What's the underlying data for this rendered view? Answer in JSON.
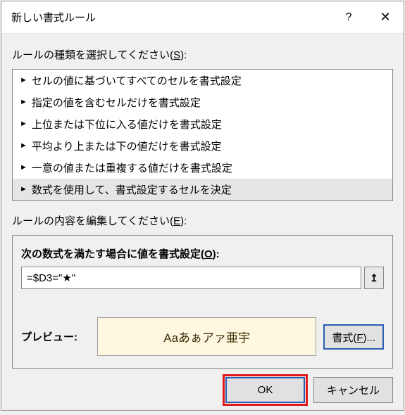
{
  "titlebar": {
    "title": "新しい書式ルール"
  },
  "section1": {
    "label_pre": "ルールの種類を選択してください(",
    "label_u": "S",
    "label_post": "):"
  },
  "rule_types": {
    "items": [
      {
        "text": "セルの値に基づいてすべてのセルを書式設定"
      },
      {
        "text": "指定の値を含むセルだけを書式設定"
      },
      {
        "text": "上位または下位に入る値だけを書式設定"
      },
      {
        "text": "平均より上または下の値だけを書式設定"
      },
      {
        "text": "一意の値または重複する値だけを書式設定"
      },
      {
        "text": "数式を使用して、書式設定するセルを決定"
      }
    ]
  },
  "section2": {
    "label_pre": "ルールの内容を編集してください(",
    "label_u": "E",
    "label_post": "):"
  },
  "edit": {
    "heading_pre": "次の数式を満たす場合に値を書式設定(",
    "heading_u": "O",
    "heading_post": "):",
    "formula": "=$D3=\"★\"",
    "preview_label": "プレビュー:",
    "preview_text": "Aaあぁアァ亜宇",
    "format_btn_pre": "書式(",
    "format_btn_u": "F",
    "format_btn_post": ")..."
  },
  "buttons": {
    "ok": "OK",
    "cancel": "キャンセル"
  }
}
